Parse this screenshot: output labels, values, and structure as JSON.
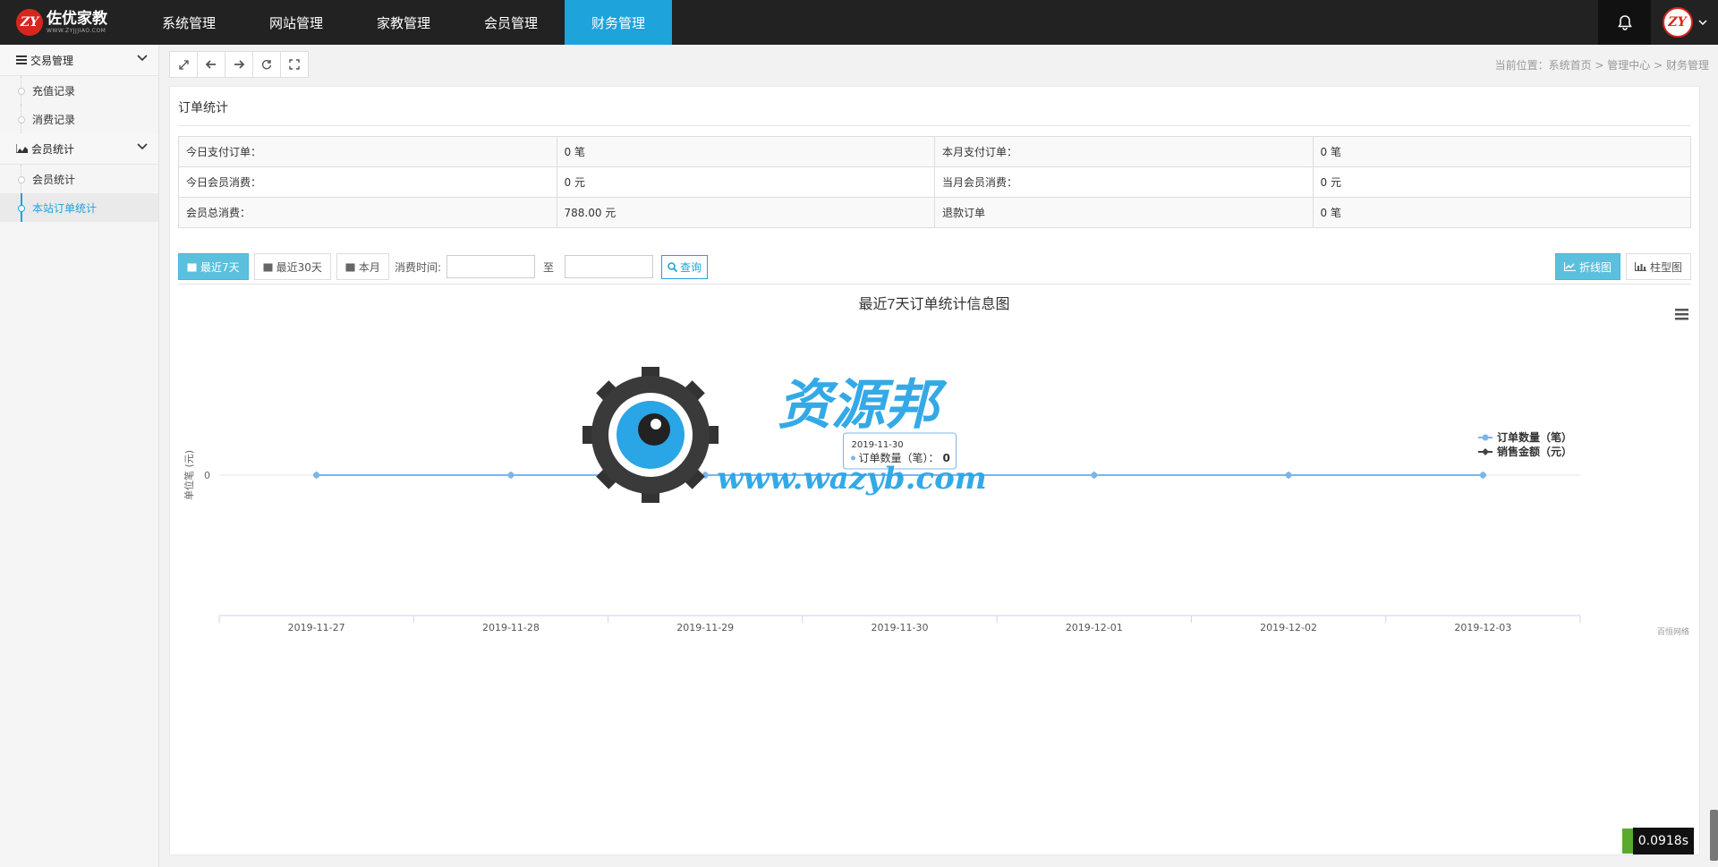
{
  "logo": {
    "mark": "ZY",
    "title": "佐优家教",
    "subtitle": "WWW.ZYJJJIAO.COM"
  },
  "nav": [
    {
      "label": "系统管理"
    },
    {
      "label": "网站管理"
    },
    {
      "label": "家教管理"
    },
    {
      "label": "会员管理"
    },
    {
      "label": "财务管理",
      "active": true
    }
  ],
  "sidebar": {
    "groups": [
      {
        "label": "交易管理",
        "items": [
          "充值记录",
          "消费记录"
        ]
      },
      {
        "label": "会员统计",
        "items": [
          "会员统计",
          "本站订单统计"
        ]
      }
    ],
    "active_item": "本站订单统计"
  },
  "breadcrumb": "当前位置：系统首页 > 管理中心 > 财务管理",
  "panel": {
    "title": "订单统计"
  },
  "stats": [
    [
      {
        "label": "今日支付订单：",
        "value": "0 笔"
      },
      {
        "label": "本月支付订单：",
        "value": "0 笔"
      }
    ],
    [
      {
        "label": "今日会员消费：",
        "value": "0 元"
      },
      {
        "label": "当月会员消费：",
        "value": "0 元"
      }
    ],
    [
      {
        "label": "会员总消费：",
        "value": "788.00 元"
      },
      {
        "label": "退款订单",
        "value": "0 笔"
      }
    ]
  ],
  "filter": {
    "btn_7days": "最近7天",
    "btn_30days": "最近30天",
    "btn_month": "本月",
    "time_label": "消费时间:",
    "to_label": "至",
    "query": "查询",
    "line_chart": "折线图",
    "bar_chart": "柱型图"
  },
  "chart_data": {
    "type": "line",
    "title": "最近7天订单统计信息图",
    "ylabel": "单位笔 (元)",
    "credit": "百恒网络",
    "categories": [
      "2019-11-27",
      "2019-11-28",
      "2019-11-29",
      "2019-11-30",
      "2019-12-01",
      "2019-12-02",
      "2019-12-03"
    ],
    "series": [
      {
        "name": "订单数量（笔）",
        "values": [
          0,
          0,
          0,
          0,
          0,
          0,
          0
        ],
        "color": "#7cb5ec"
      },
      {
        "name": "销售金额（元）",
        "values": [
          0,
          0,
          0,
          0,
          0,
          0,
          0
        ],
        "color": "#434348"
      }
    ],
    "yticks": [
      "0"
    ],
    "legend": "right",
    "tooltip": {
      "date": "2019-11-30",
      "label": "订单数量（笔）",
      "value": "0"
    }
  },
  "watermark": {
    "title": "资源邦",
    "url": "www.wazyb.com"
  },
  "timer": "0.0918s",
  "colors": {
    "accent": "#1ea3db",
    "topbar": "#222222",
    "primary_btn": "#5bc0de"
  }
}
